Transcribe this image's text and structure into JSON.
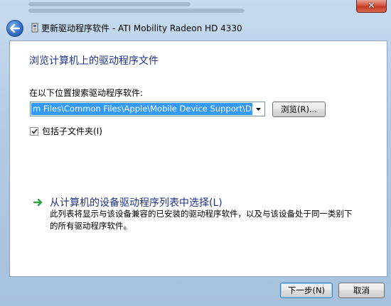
{
  "window": {
    "title": "更新驱动程序软件 - ATI Mobility Radeon HD 4330",
    "close_glyph": "✕"
  },
  "content": {
    "heading": "浏览计算机上的驱动程序文件",
    "search_label": "在以下位置搜索驱动程序软件:",
    "path_value": "m Files\\Common Files\\Apple\\Mobile Device Support\\Drivers",
    "browse_label": "浏览(R)...",
    "include_subfolders": {
      "label": "包括子文件夹(I)",
      "checked": true
    },
    "pick_link": "从计算机的设备驱动程序列表中选择(L)",
    "pick_description": "此列表将显示与该设备兼容的已安装的驱动程序软件，以及与该设备处于同一类别下的所有驱动程序软件。"
  },
  "footer": {
    "next_label": "下一步(N)",
    "cancel_label": "取消"
  },
  "colors": {
    "accent_link": "#1e3287",
    "selection": "#3399ff",
    "arrow_green": "#2ea043"
  },
  "icons": [
    "back-arrow-icon",
    "wizard-icon",
    "dropdown-arrow-icon",
    "checkmark-icon",
    "green-arrow-icon",
    "close-icon"
  ]
}
